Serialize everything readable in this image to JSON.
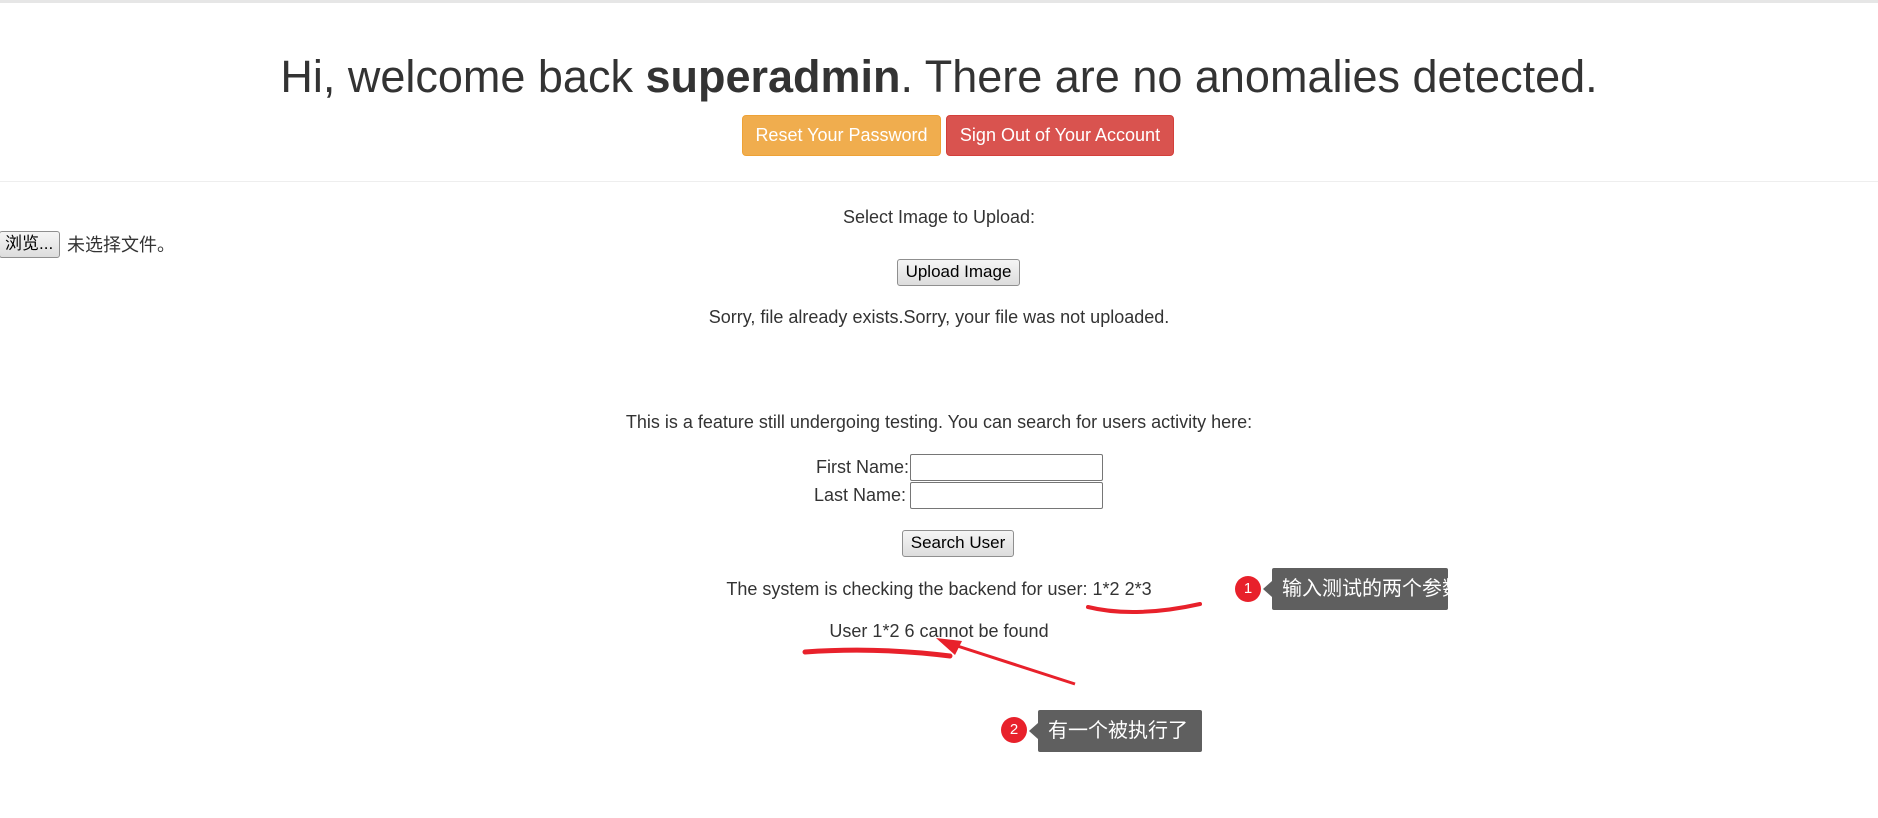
{
  "header": {
    "welcome_prefix": "Hi, welcome back ",
    "username": "superadmin",
    "welcome_suffix": ". There are no anomalies detected.",
    "reset_password_label": "Reset Your Password",
    "sign_out_label": "Sign Out of Your Account"
  },
  "upload": {
    "title": "Select Image to Upload:",
    "browse_label": "浏览...",
    "no_file_text": "未选择文件。",
    "upload_button_label": "Upload Image",
    "status_text": "Sorry, file already exists.Sorry, your file was not uploaded."
  },
  "search": {
    "description": "This is a feature still undergoing testing. You can search for users activity here:",
    "first_name_label": "First Name:",
    "first_name_value": "",
    "last_name_label": "Last Name:",
    "last_name_value": "",
    "search_button_label": "Search User",
    "checking_text": "The system is checking the backend for user: 1*2 2*3",
    "not_found_text": "User 1*2 6 cannot be found"
  },
  "annotations": {
    "callout_1": {
      "number": "1",
      "text": "输入测试的两个参数"
    },
    "callout_2": {
      "number": "2",
      "text": "有一个被执行了"
    },
    "marker_color": "#e8212b"
  },
  "colors": {
    "warning": "#f0ad4e",
    "danger": "#d9534f",
    "callout_bg": "#5f5f5f"
  }
}
